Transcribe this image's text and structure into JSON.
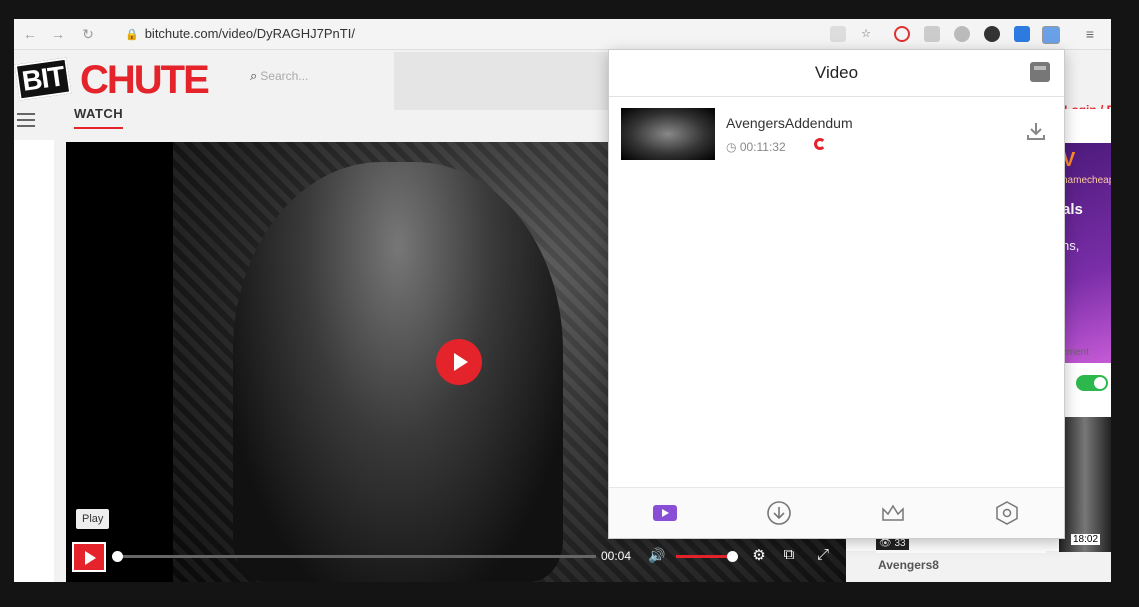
{
  "browser": {
    "url": "bitchute.com/video/DyRAGHJ7PnTI/",
    "back_icon": "←",
    "forward_icon": "→",
    "reload_icon": "↻",
    "lock_icon": "🔒",
    "star_icon": "☆",
    "menu_icon": "≡"
  },
  "site": {
    "logo_bit": "BIT",
    "logo_chute": "CHUTE",
    "search_placeholder": "Search...",
    "watch_tab": "WATCH",
    "login_text": "Login / Re",
    "brand_color": "#e4232b"
  },
  "player": {
    "tooltip": "Play",
    "current_time": "00:04",
    "volume_icon": "🔊",
    "settings_icon": "⚙",
    "popout_icon": "⧉",
    "fullscreen_icon": "⤢"
  },
  "ad": {
    "brand_mark": "V",
    "brand_name": "namecheap",
    "heading": "als",
    "body": "ns,",
    "disclaimer": "isement"
  },
  "related": {
    "views_badge": "33",
    "duration_badge": "18:02",
    "title": "Avengers8"
  },
  "popup": {
    "title": "Video",
    "item": {
      "name": "AvengersAddendum",
      "duration": "00:11:32"
    }
  }
}
